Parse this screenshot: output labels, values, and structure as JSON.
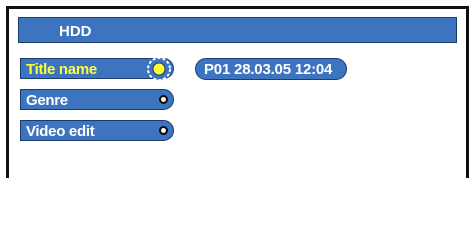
{
  "header": {
    "title": "HDD"
  },
  "menu": {
    "items": [
      {
        "label": "Title name",
        "selected": true
      },
      {
        "label": "Genre",
        "selected": false
      },
      {
        "label": "Video edit",
        "selected": false
      }
    ]
  },
  "info": {
    "value": "P01 28.03.05 12:04"
  },
  "icons": {
    "selected_item": "selection-cursor-icon",
    "menu_item": "menu-bullet-icon"
  },
  "colors": {
    "panel_blue": "#3d74c0",
    "text_white": "#ffffff",
    "highlight_yellow": "#ffff33"
  }
}
